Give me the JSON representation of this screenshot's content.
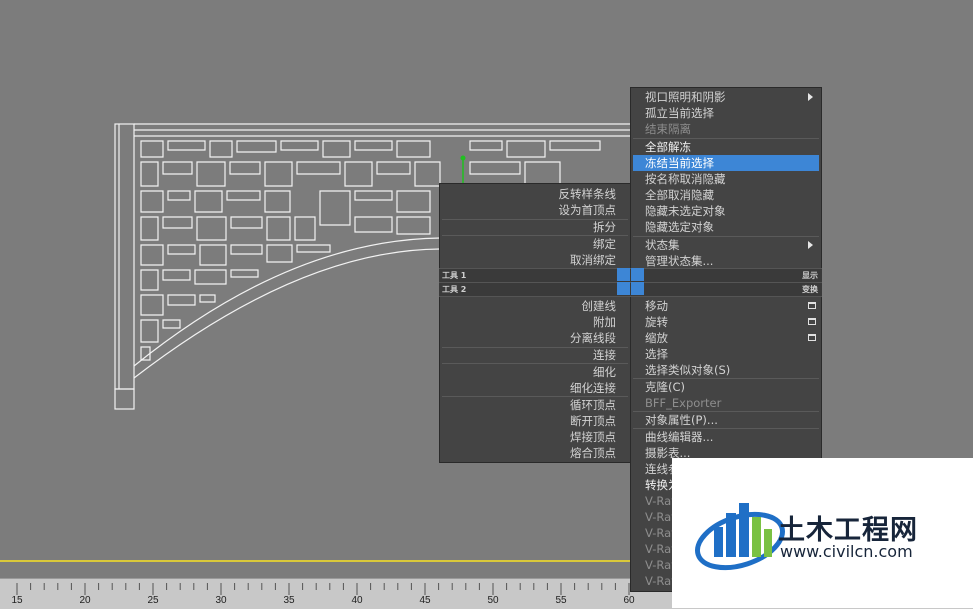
{
  "viewport": {
    "background": "#7c7c7c",
    "ground_line_color": "#d9c83a"
  },
  "ruler": {
    "labels": [
      "15",
      "20",
      "25",
      "30",
      "35",
      "40",
      "45",
      "50",
      "55",
      "60"
    ]
  },
  "quad_menu": {
    "highlight_color": "#3d86d6",
    "left_items": [
      {
        "label": "反转样条线"
      },
      {
        "label": "设为首顶点"
      },
      {
        "label": "拆分"
      },
      {
        "label": "绑定"
      },
      {
        "label": "取消绑定"
      },
      {
        "label": "创建线"
      },
      {
        "label": "附加"
      },
      {
        "label": "分离线段"
      },
      {
        "label": "连接"
      },
      {
        "label": "细化"
      },
      {
        "label": "细化连接"
      },
      {
        "label": "循环顶点"
      },
      {
        "label": "断开顶点"
      },
      {
        "label": "焊接顶点"
      },
      {
        "label": "熔合顶点"
      }
    ],
    "bars": [
      {
        "left": "工具 1",
        "right": "显示"
      },
      {
        "left": "工具 2",
        "right": "变换"
      }
    ],
    "right_items": [
      {
        "label": "视口照明和阴影"
      },
      {
        "label": "孤立当前选择"
      },
      {
        "label": "结束隔离"
      },
      {
        "label": "全部解冻"
      },
      {
        "label": "冻结当前选择"
      },
      {
        "label": "按名称取消隐藏"
      },
      {
        "label": "全部取消隐藏"
      },
      {
        "label": "隐藏未选定对象"
      },
      {
        "label": "隐藏选定对象"
      },
      {
        "label": "状态集"
      },
      {
        "label": "管理状态集..."
      },
      {
        "label": "移动"
      },
      {
        "label": "旋转"
      },
      {
        "label": "缩放"
      },
      {
        "label": "选择"
      },
      {
        "label": "选择类似对象(S)"
      },
      {
        "label": "克隆(C)"
      },
      {
        "label": "BFF_Exporter"
      },
      {
        "label": "对象属性(P)..."
      },
      {
        "label": "曲线编辑器..."
      },
      {
        "label": "摄影表..."
      },
      {
        "label": "连线参数..."
      },
      {
        "label": "转换为:"
      },
      {
        "label": "V-Ray 属性"
      },
      {
        "label": "V-Ray 场景转换器"
      },
      {
        "label": "V-Ray 网格导出"
      },
      {
        "label": "V-Ray 虚拟帧缓冲区"
      },
      {
        "label": "V-Ray 场景文件导出器"
      },
      {
        "label": "V-Ray 动画场景导出器"
      }
    ]
  },
  "watermark": {
    "name": "土木工程网",
    "url": "www.civilcn.com",
    "colors": {
      "blue": "#1f6fc6",
      "green": "#7ac143",
      "navy": "#17253a"
    }
  }
}
